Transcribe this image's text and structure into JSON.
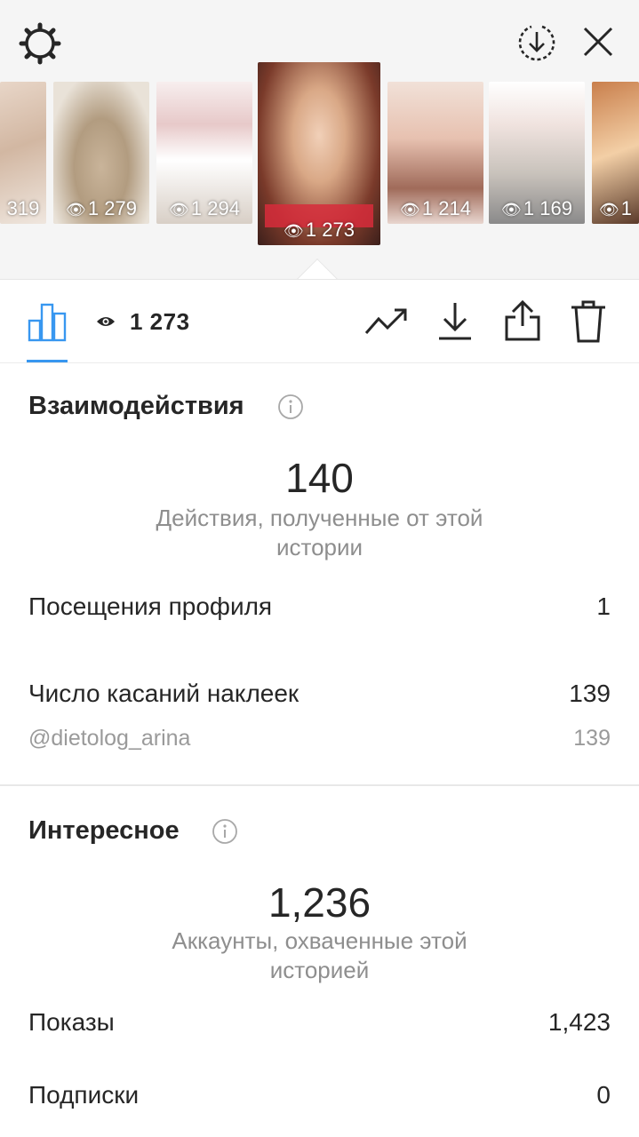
{
  "header": {
    "icons": {
      "settings": "gear-icon",
      "download": "download-circle-icon",
      "close": "close-icon"
    }
  },
  "stories": [
    {
      "views": "319"
    },
    {
      "views": "1 279"
    },
    {
      "views": "1 294"
    },
    {
      "views": "1 273",
      "selected": true
    },
    {
      "views": "1 214"
    },
    {
      "views": "1 169"
    },
    {
      "views": "1"
    }
  ],
  "toolbar": {
    "views_count": "1 273",
    "accent": "#3897f0",
    "icons": [
      "bar-chart-icon",
      "eye-icon",
      "trend-icon",
      "download-icon",
      "share-icon",
      "trash-icon"
    ]
  },
  "interactions": {
    "title": "Взаимодействия",
    "total": "140",
    "total_caption": "Действия, полученные от этой истории",
    "profile_visits_label": "Посещения профиля",
    "profile_visits_value": "1",
    "sticker_taps_label": "Число касаний наклеек",
    "sticker_taps_value": "139",
    "sticker_handle": "@dietolog_arina",
    "sticker_handle_value": "139"
  },
  "discovery": {
    "title": "Интересное",
    "total": "1,236",
    "total_caption": "Аккаунты, охваченные этой историей",
    "impressions_label": "Показы",
    "impressions_value": "1,423",
    "follows_label": "Подписки",
    "follows_value": "0"
  }
}
